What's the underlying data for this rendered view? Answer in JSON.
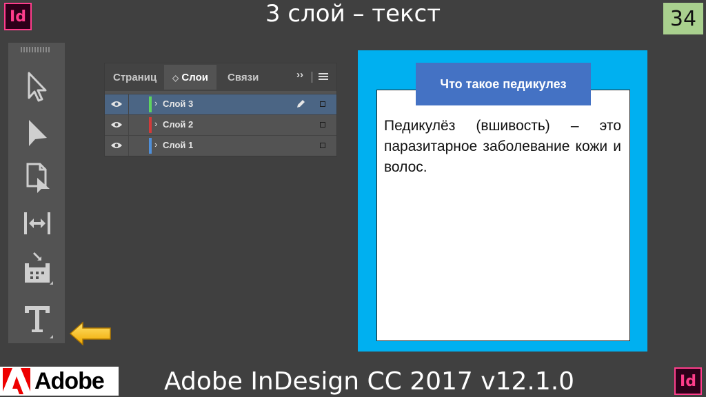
{
  "slide": {
    "title": "3 слой – текст",
    "number": "34",
    "logo_label": "Id",
    "footer": "Adobe InDesign CC 2017 v12.1.0",
    "adobe_word": "Adobe"
  },
  "colors": {
    "background": "#404040",
    "indesign_pink": "#ff3d8b",
    "slide_number_bg": "#a9d08e",
    "frame_blue": "#00b0f0",
    "tag_blue": "#4472c4",
    "arrow_yellow": "#ffc000"
  },
  "toolbox": {
    "tools": [
      "selection-tool-icon",
      "direct-selection-tool-icon",
      "page-tool-icon",
      "gap-tool-icon",
      "content-collector-icon",
      "type-tool-icon"
    ]
  },
  "layers_panel": {
    "tabs": [
      {
        "label": "Страниц",
        "active": false
      },
      {
        "label": "Слои",
        "active": true
      },
      {
        "label": "Связи",
        "active": false
      }
    ],
    "tab_prefix": "◇",
    "menu_more": "››",
    "layers": [
      {
        "name": "Слой 3",
        "color": "#5fd35f",
        "selected": true
      },
      {
        "name": "Слой 2",
        "color": "#d23a3a",
        "selected": false
      },
      {
        "name": "Слой 1",
        "color": "#4f8fd9",
        "selected": false
      }
    ]
  },
  "page": {
    "heading": "Что такое педикулез",
    "body": "Педикулёз (вшивость) – это паразитарное заболевание кожи и волос."
  }
}
